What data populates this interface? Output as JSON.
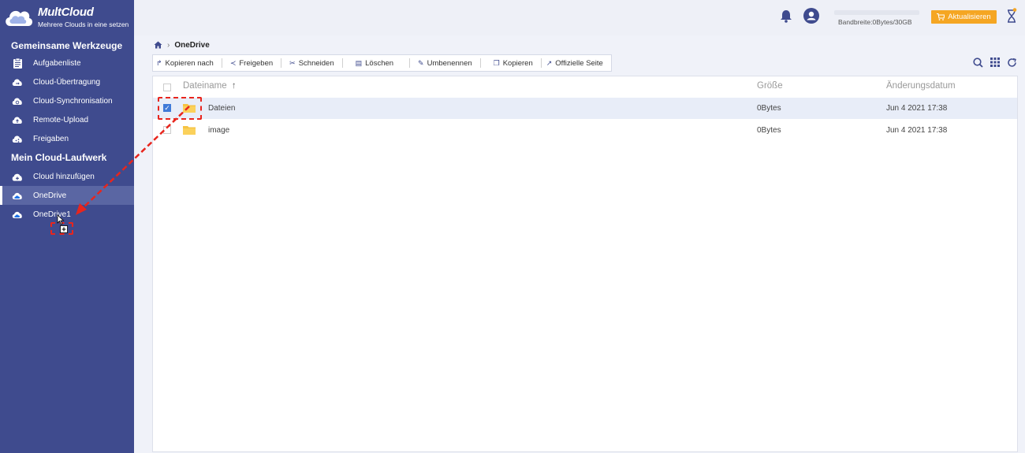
{
  "app": {
    "name": "MultCloud",
    "tagline": "Mehrere Clouds in eine setzen"
  },
  "sidebar": {
    "section_tools": "Gemeinsame Werkzeuge",
    "tools": [
      {
        "label": "Aufgabenliste",
        "icon": "task-list-icon"
      },
      {
        "label": "Cloud-Übertragung",
        "icon": "cloud-transfer-icon"
      },
      {
        "label": "Cloud-Synchronisation",
        "icon": "cloud-sync-icon"
      },
      {
        "label": "Remote-Upload",
        "icon": "remote-upload-icon"
      },
      {
        "label": "Freigaben",
        "icon": "share-icon"
      }
    ],
    "section_drives": "Mein Cloud-Laufwerk",
    "add_cloud": "Cloud hinzufügen",
    "drives": [
      {
        "label": "OneDrive",
        "active": true
      },
      {
        "label": "OneDrive1",
        "active": false
      }
    ]
  },
  "header": {
    "bandwidth": "Bandbreite:0Bytes/30GB",
    "bandwidth_used": 0,
    "upgrade_label": "Aktualisieren"
  },
  "breadcrumb": {
    "current": "OneDrive"
  },
  "toolbar": {
    "copy_to": "Kopieren nach",
    "share": "Freigeben",
    "cut": "Schneiden",
    "delete": "Löschen",
    "rename": "Umbenennen",
    "copy": "Kopieren",
    "official": "Offizielle Seite"
  },
  "table": {
    "col_name": "Dateiname",
    "col_size": "Größe",
    "col_date": "Änderungsdatum",
    "sort_indicator": "↑",
    "rows": [
      {
        "name": "Dateien",
        "size": "0Bytes",
        "date": "Jun 4 2021 17:38",
        "selected": true
      },
      {
        "name": "image",
        "size": "0Bytes",
        "date": "Jun 4 2021 17:38",
        "selected": false
      }
    ]
  },
  "colors": {
    "sidebar_bg": "#3f4b8e",
    "accent": "#f5a623",
    "annotation": "#e8251d"
  }
}
